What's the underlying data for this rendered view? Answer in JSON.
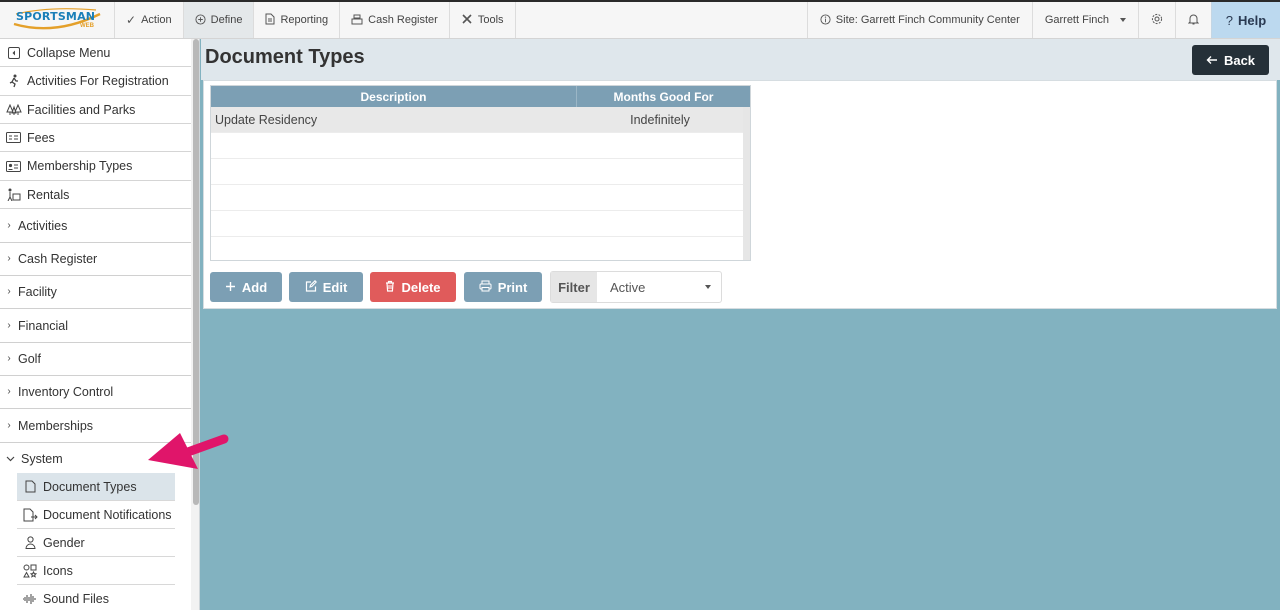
{
  "app": {
    "logo_text": "SPORTSMAN",
    "logo_sub": "WEB"
  },
  "topnav": {
    "items": [
      {
        "label": "Action",
        "icon": "check-icon"
      },
      {
        "label": "Define",
        "icon": "plus-circle-icon",
        "active": true
      },
      {
        "label": "Reporting",
        "icon": "document-icon"
      },
      {
        "label": "Cash Register",
        "icon": "register-icon"
      },
      {
        "label": "Tools",
        "icon": "tools-icon"
      }
    ],
    "site_label": "Site: Garrett Finch Community Center",
    "user_label": "Garrett Finch",
    "help_label": "Help"
  },
  "sidebar": {
    "top_items": [
      {
        "label": "Collapse Menu",
        "icon": "collapse-icon"
      },
      {
        "label": "Activities For Registration",
        "icon": "runner-icon"
      },
      {
        "label": "Facilities and Parks",
        "icon": "trees-icon"
      },
      {
        "label": "Fees",
        "icon": "fee-card-icon"
      },
      {
        "label": "Membership Types",
        "icon": "id-card-icon"
      },
      {
        "label": "Rentals",
        "icon": "rentals-icon"
      }
    ],
    "groups": [
      {
        "label": "Activities"
      },
      {
        "label": "Cash Register"
      },
      {
        "label": "Facility"
      },
      {
        "label": "Financial"
      },
      {
        "label": "Golf"
      },
      {
        "label": "Inventory Control"
      },
      {
        "label": "Memberships"
      },
      {
        "label": "System",
        "expanded": true
      }
    ],
    "system_items": [
      {
        "label": "Document Types",
        "icon": "file-icon",
        "selected": true
      },
      {
        "label": "Document Notifications",
        "icon": "file-export-icon"
      },
      {
        "label": "Gender",
        "icon": "person-icon"
      },
      {
        "label": "Icons",
        "icon": "icons-icon"
      },
      {
        "label": "Sound Files",
        "icon": "waveform-icon"
      }
    ]
  },
  "page": {
    "title": "Document Types",
    "back_label": "Back"
  },
  "grid": {
    "columns": [
      "Description",
      "Months Good For"
    ],
    "rows": [
      [
        "Update Residency",
        "Indefinitely"
      ]
    ]
  },
  "actions": {
    "add_label": "Add",
    "edit_label": "Edit",
    "delete_label": "Delete",
    "print_label": "Print",
    "filter_label": "Filter",
    "filter_value": "Active"
  },
  "colors": {
    "accent": "#7c9fb4",
    "danger": "#e05b5b",
    "dark": "#253038",
    "annotation": "#e0156a"
  }
}
